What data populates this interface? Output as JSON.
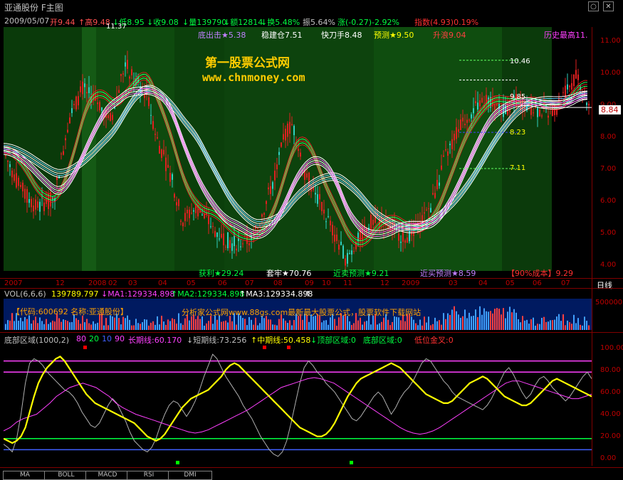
{
  "window": {
    "title": "亚通股份 F主图",
    "buttons": [
      "○",
      "✕"
    ]
  },
  "quote": {
    "date": "2009/05/07",
    "open": "开9.44",
    "high": "↑高9.48",
    "low": "↓低8.95",
    "close": "↓收9.08",
    "vol": "↓量139790",
    "amount": "↓额12814",
    "turnover": "↓换5.48%",
    "amplitude": "振5.64%",
    "change": "涨(-0.27)-2.92%",
    "index": "指数(4.93)0.19%"
  },
  "price_panel": {
    "annotations_top": [
      "底出击★5.38",
      "稳建仓7.51",
      "快刀手8.48",
      "预测★9.50",
      "升浪9.04",
      "历史最高11."
    ],
    "peak_label": "11.37",
    "watermark_title": "第一股票公式网",
    "watermark_url": "www.chnmoney.com",
    "annotations_bottom": [
      "获利★29.24",
      "套牢★70.76",
      "近卖预测★9.21",
      "近买预测★8.59",
      "【90%成本】9.29"
    ],
    "level_labels": [
      "10.46",
      "9.85",
      "8.23",
      "7.11"
    ],
    "current_price": "8.84",
    "y_ticks": [
      "11.00",
      "10.00",
      "9.00",
      "8.00",
      "7.00",
      "6.00",
      "5.00",
      "4.00"
    ]
  },
  "x_axis": {
    "labels": [
      "2007",
      "12",
      "2008",
      "02",
      "03",
      "04",
      "05",
      "06",
      "07",
      "08",
      "09",
      "10",
      "11",
      "12",
      "2009",
      "03",
      "04",
      "05",
      "06",
      "07"
    ],
    "corner": "日线"
  },
  "volume": {
    "header": [
      "VOL(6,6,6)",
      "139789.797",
      "↓MA1:129334.898",
      "↑MA2:129334.898",
      "↑MA3:129334.898",
      "↑"
    ],
    "overlay_code": "【代码:600692  名称:亚通股份】",
    "overlay_ad": "分析家公式网www.88gs.com最新最大股票公式，股票软件下载网站",
    "y_tick": "500000"
  },
  "oscillator": {
    "header": [
      "底部区域(1000,2)",
      "80",
      "20",
      "10",
      "90",
      "长期线:60.170",
      "↓短期线:73.256",
      "↑中期线:50.458",
      "↓顶部区域:0",
      "底部区域:0",
      "低位金叉:0"
    ],
    "y_ticks": [
      "100.00",
      "80.00",
      "60.00",
      "40.00",
      "20.00",
      "0.00"
    ],
    "series": {
      "long_term": [
        27,
        30,
        35,
        38,
        40,
        42,
        47,
        52,
        58,
        62,
        66,
        68,
        70,
        68,
        66,
        62,
        58,
        52,
        48,
        45,
        42,
        40,
        38,
        36,
        34,
        32,
        30,
        28,
        26,
        25,
        26,
        28,
        31,
        34,
        37,
        40,
        43,
        46,
        50,
        54,
        58,
        62,
        66,
        68,
        70,
        72,
        74,
        75,
        74,
        72,
        70,
        66,
        62,
        58,
        54,
        50,
        46,
        42,
        38,
        34,
        30,
        27,
        25,
        24,
        25,
        27,
        30,
        34,
        38,
        42,
        46,
        50,
        54,
        58,
        62,
        66,
        70,
        72,
        72,
        70,
        68,
        66,
        64,
        62,
        60,
        58,
        56,
        56,
        58,
        60
      ],
      "short_term": [
        15,
        12,
        8,
        20,
        42,
        70,
        88,
        92,
        90,
        86,
        80,
        76,
        72,
        68,
        64,
        62,
        58,
        52,
        44,
        38,
        32,
        30,
        34,
        42,
        50,
        56,
        52,
        44,
        36,
        26,
        18,
        14,
        10,
        8,
        12,
        20,
        32,
        42,
        50,
        54,
        52,
        46,
        40,
        46,
        54,
        64,
        76,
        86,
        96,
        92,
        84,
        76,
        70,
        64,
        58,
        50,
        44,
        38,
        30,
        22,
        16,
        10,
        6,
        4,
        8,
        18,
        34,
        52,
        70,
        84,
        90,
        86,
        80,
        76,
        70,
        66,
        62,
        56,
        50,
        44,
        38,
        36,
        40,
        46,
        52,
        58,
        62,
        58,
        50,
        42,
        48,
        56,
        62,
        66,
        72,
        80,
        88,
        92,
        90,
        84,
        78,
        72,
        68,
        62,
        58,
        56,
        54,
        52,
        50,
        48,
        46,
        50,
        56,
        64,
        72,
        80,
        84,
        78,
        70,
        62,
        56,
        60,
        68,
        74,
        76,
        72,
        66,
        62,
        58,
        54,
        58,
        64,
        70,
        76,
        80,
        74
      ],
      "mid_term": [
        20,
        18,
        16,
        18,
        22,
        30,
        44,
        58,
        70,
        78,
        84,
        88,
        92,
        94,
        90,
        84,
        78,
        72,
        66,
        60,
        56,
        52,
        50,
        48,
        46,
        44,
        42,
        40,
        38,
        36,
        34,
        30,
        26,
        22,
        20,
        18,
        20,
        24,
        30,
        36,
        42,
        48,
        52,
        56,
        58,
        60,
        62,
        64,
        68,
        72,
        76,
        82,
        86,
        88,
        86,
        82,
        78,
        74,
        70,
        66,
        62,
        58,
        54,
        50,
        46,
        42,
        38,
        34,
        30,
        28,
        26,
        24,
        22,
        22,
        24,
        28,
        34,
        42,
        50,
        58,
        64,
        70,
        74,
        76,
        78,
        80,
        82,
        84,
        86,
        88,
        86,
        84,
        80,
        76,
        72,
        68,
        64,
        60,
        58,
        56,
        54,
        52,
        52,
        54,
        58,
        62,
        66,
        70,
        72,
        74,
        76,
        74,
        70,
        66,
        62,
        58,
        56,
        54,
        52,
        50,
        50,
        52,
        56,
        60,
        64,
        68,
        72,
        74,
        72,
        70,
        68,
        66,
        64,
        62,
        60,
        58
      ]
    },
    "signal_colors": {
      "bottom": "#00ff00",
      "top": "#ff0000"
    }
  },
  "tabs": [
    "MA",
    "BOLL",
    "MACD",
    "RSI",
    "DMI"
  ],
  "colors": {
    "up": "#ff3030",
    "down": "#00ff40",
    "ma_cyan": "#60d0ff",
    "ma_pink": "#ff60ff",
    "yellow": "#ffff00",
    "magenta": "#ff00ff",
    "axis_red": "#c00000",
    "bg_green": "#0e4a0e"
  }
}
